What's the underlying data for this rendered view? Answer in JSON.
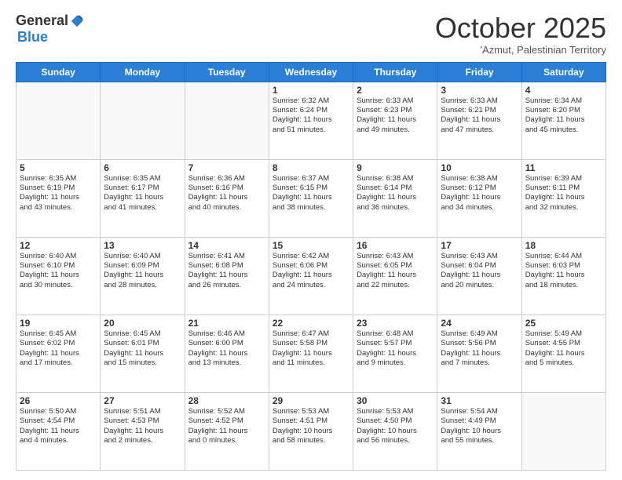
{
  "logo": {
    "general": "General",
    "blue": "Blue"
  },
  "title": "October 2025",
  "subtitle": "'Azmut, Palestinian Territory",
  "days": [
    "Sunday",
    "Monday",
    "Tuesday",
    "Wednesday",
    "Thursday",
    "Friday",
    "Saturday"
  ],
  "weeks": [
    [
      {
        "day": "",
        "lines": []
      },
      {
        "day": "",
        "lines": []
      },
      {
        "day": "",
        "lines": []
      },
      {
        "day": "1",
        "lines": [
          "Sunrise: 6:32 AM",
          "Sunset: 6:24 PM",
          "Daylight: 11 hours",
          "and 51 minutes."
        ]
      },
      {
        "day": "2",
        "lines": [
          "Sunrise: 6:33 AM",
          "Sunset: 6:23 PM",
          "Daylight: 11 hours",
          "and 49 minutes."
        ]
      },
      {
        "day": "3",
        "lines": [
          "Sunrise: 6:33 AM",
          "Sunset: 6:21 PM",
          "Daylight: 11 hours",
          "and 47 minutes."
        ]
      },
      {
        "day": "4",
        "lines": [
          "Sunrise: 6:34 AM",
          "Sunset: 6:20 PM",
          "Daylight: 11 hours",
          "and 45 minutes."
        ]
      }
    ],
    [
      {
        "day": "5",
        "lines": [
          "Sunrise: 6:35 AM",
          "Sunset: 6:19 PM",
          "Daylight: 11 hours",
          "and 43 minutes."
        ]
      },
      {
        "day": "6",
        "lines": [
          "Sunrise: 6:35 AM",
          "Sunset: 6:17 PM",
          "Daylight: 11 hours",
          "and 41 minutes."
        ]
      },
      {
        "day": "7",
        "lines": [
          "Sunrise: 6:36 AM",
          "Sunset: 6:16 PM",
          "Daylight: 11 hours",
          "and 40 minutes."
        ]
      },
      {
        "day": "8",
        "lines": [
          "Sunrise: 6:37 AM",
          "Sunset: 6:15 PM",
          "Daylight: 11 hours",
          "and 38 minutes."
        ]
      },
      {
        "day": "9",
        "lines": [
          "Sunrise: 6:38 AM",
          "Sunset: 6:14 PM",
          "Daylight: 11 hours",
          "and 36 minutes."
        ]
      },
      {
        "day": "10",
        "lines": [
          "Sunrise: 6:38 AM",
          "Sunset: 6:12 PM",
          "Daylight: 11 hours",
          "and 34 minutes."
        ]
      },
      {
        "day": "11",
        "lines": [
          "Sunrise: 6:39 AM",
          "Sunset: 6:11 PM",
          "Daylight: 11 hours",
          "and 32 minutes."
        ]
      }
    ],
    [
      {
        "day": "12",
        "lines": [
          "Sunrise: 6:40 AM",
          "Sunset: 6:10 PM",
          "Daylight: 11 hours",
          "and 30 minutes."
        ]
      },
      {
        "day": "13",
        "lines": [
          "Sunrise: 6:40 AM",
          "Sunset: 6:09 PM",
          "Daylight: 11 hours",
          "and 28 minutes."
        ]
      },
      {
        "day": "14",
        "lines": [
          "Sunrise: 6:41 AM",
          "Sunset: 6:08 PM",
          "Daylight: 11 hours",
          "and 26 minutes."
        ]
      },
      {
        "day": "15",
        "lines": [
          "Sunrise: 6:42 AM",
          "Sunset: 6:06 PM",
          "Daylight: 11 hours",
          "and 24 minutes."
        ]
      },
      {
        "day": "16",
        "lines": [
          "Sunrise: 6:43 AM",
          "Sunset: 6:05 PM",
          "Daylight: 11 hours",
          "and 22 minutes."
        ]
      },
      {
        "day": "17",
        "lines": [
          "Sunrise: 6:43 AM",
          "Sunset: 6:04 PM",
          "Daylight: 11 hours",
          "and 20 minutes."
        ]
      },
      {
        "day": "18",
        "lines": [
          "Sunrise: 6:44 AM",
          "Sunset: 6:03 PM",
          "Daylight: 11 hours",
          "and 18 minutes."
        ]
      }
    ],
    [
      {
        "day": "19",
        "lines": [
          "Sunrise: 6:45 AM",
          "Sunset: 6:02 PM",
          "Daylight: 11 hours",
          "and 17 minutes."
        ]
      },
      {
        "day": "20",
        "lines": [
          "Sunrise: 6:45 AM",
          "Sunset: 6:01 PM",
          "Daylight: 11 hours",
          "and 15 minutes."
        ]
      },
      {
        "day": "21",
        "lines": [
          "Sunrise: 6:46 AM",
          "Sunset: 6:00 PM",
          "Daylight: 11 hours",
          "and 13 minutes."
        ]
      },
      {
        "day": "22",
        "lines": [
          "Sunrise: 6:47 AM",
          "Sunset: 5:58 PM",
          "Daylight: 11 hours",
          "and 11 minutes."
        ]
      },
      {
        "day": "23",
        "lines": [
          "Sunrise: 6:48 AM",
          "Sunset: 5:57 PM",
          "Daylight: 11 hours",
          "and 9 minutes."
        ]
      },
      {
        "day": "24",
        "lines": [
          "Sunrise: 6:49 AM",
          "Sunset: 5:56 PM",
          "Daylight: 11 hours",
          "and 7 minutes."
        ]
      },
      {
        "day": "25",
        "lines": [
          "Sunrise: 5:49 AM",
          "Sunset: 4:55 PM",
          "Daylight: 11 hours",
          "and 5 minutes."
        ]
      }
    ],
    [
      {
        "day": "26",
        "lines": [
          "Sunrise: 5:50 AM",
          "Sunset: 4:54 PM",
          "Daylight: 11 hours",
          "and 4 minutes."
        ]
      },
      {
        "day": "27",
        "lines": [
          "Sunrise: 5:51 AM",
          "Sunset: 4:53 PM",
          "Daylight: 11 hours",
          "and 2 minutes."
        ]
      },
      {
        "day": "28",
        "lines": [
          "Sunrise: 5:52 AM",
          "Sunset: 4:52 PM",
          "Daylight: 11 hours",
          "and 0 minutes."
        ]
      },
      {
        "day": "29",
        "lines": [
          "Sunrise: 5:53 AM",
          "Sunset: 4:51 PM",
          "Daylight: 10 hours",
          "and 58 minutes."
        ]
      },
      {
        "day": "30",
        "lines": [
          "Sunrise: 5:53 AM",
          "Sunset: 4:50 PM",
          "Daylight: 10 hours",
          "and 56 minutes."
        ]
      },
      {
        "day": "31",
        "lines": [
          "Sunrise: 5:54 AM",
          "Sunset: 4:49 PM",
          "Daylight: 10 hours",
          "and 55 minutes."
        ]
      },
      {
        "day": "",
        "lines": []
      }
    ]
  ]
}
